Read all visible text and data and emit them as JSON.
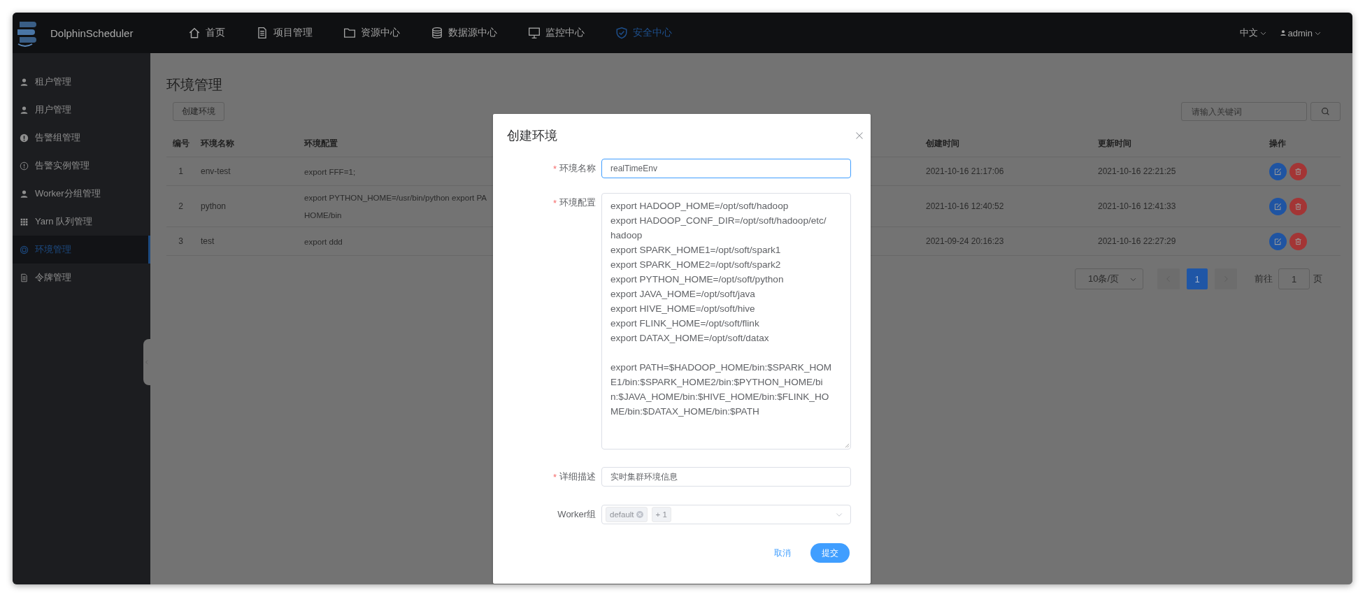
{
  "header": {
    "logo": "DolphinScheduler",
    "nav": [
      {
        "label": "首页",
        "selected": false
      },
      {
        "label": "项目管理",
        "selected": false
      },
      {
        "label": "资源中心",
        "selected": false
      },
      {
        "label": "数据源中心",
        "selected": false
      },
      {
        "label": "监控中心",
        "selected": false
      },
      {
        "label": "安全中心",
        "selected": true
      }
    ],
    "language": "中文",
    "user": "admin"
  },
  "sidebar": {
    "items": [
      {
        "label": "租户管理",
        "selected": false
      },
      {
        "label": "用户管理",
        "selected": false
      },
      {
        "label": "告警组管理",
        "selected": false
      },
      {
        "label": "告警实例管理",
        "selected": false
      },
      {
        "label": "Worker分组管理",
        "selected": false
      },
      {
        "label": "Yarn 队列管理",
        "selected": false
      },
      {
        "label": "环境管理",
        "selected": true
      },
      {
        "label": "令牌管理",
        "selected": false
      }
    ]
  },
  "page": {
    "title": "环境管理",
    "create_button": "创建环境",
    "search": {
      "placeholder": "请输入关键词"
    },
    "table": {
      "columns": [
        "编号",
        "环境名称",
        "环境配置",
        "创建时间",
        "更新时间",
        "操作"
      ],
      "rows": [
        {
          "id": "1",
          "name": "env-test",
          "config": "export FFF=1;",
          "created": "2021-10-16 21:17:06",
          "updated": "2021-10-16 22:21:25"
        },
        {
          "id": "2",
          "name": "python",
          "config": "export PYTHON_HOME=/usr/bin/python export PA\nHOME/bin",
          "created": "2021-10-16 12:40:52",
          "updated": "2021-10-16 12:41:33"
        },
        {
          "id": "3",
          "name": "test",
          "config": "export ddd",
          "created": "2021-09-24 20:16:23",
          "updated": "2021-10-16 22:27:29"
        }
      ]
    },
    "pagination": {
      "page_size": "10条/页",
      "pages": [
        {
          "label": "1",
          "selected": true
        }
      ],
      "goto_label": "前往",
      "goto_value": "1",
      "page_suffix": "页"
    }
  },
  "modal": {
    "title": "创建环境",
    "fields": [
      {
        "kind": "input",
        "label": "环境名称",
        "required_mark": "*",
        "value": "realTimeEnv",
        "focused": true
      },
      {
        "kind": "textarea",
        "label": "环境配置",
        "required_mark": "*",
        "value": "export HADOOP_HOME=/opt/soft/hadoop\nexport HADOOP_CONF_DIR=/opt/soft/hadoop/etc/\nhadoop\nexport SPARK_HOME1=/opt/soft/spark1\nexport SPARK_HOME2=/opt/soft/spark2\nexport PYTHON_HOME=/opt/soft/python\nexport JAVA_HOME=/opt/soft/java\nexport HIVE_HOME=/opt/soft/hive\nexport FLINK_HOME=/opt/soft/flink\nexport DATAX_HOME=/opt/soft/datax\n\nexport PATH=$HADOOP_HOME/bin:$SPARK_HOM\nE1/bin:$SPARK_HOME2/bin:$PYTHON_HOME/bi\nn:$JAVA_HOME/bin:$HIVE_HOME/bin:$FLINK_HO\nME/bin:$DATAX_HOME/bin:$PATH"
      },
      {
        "kind": "input",
        "label": "详细描述",
        "required_mark": "*",
        "value": "实时集群环境信息",
        "focused": false
      },
      {
        "kind": "select",
        "label": "Worker组",
        "tags": [
          {
            "label": "default",
            "closable": true
          },
          {
            "label": "+ 1",
            "closable": false
          }
        ]
      }
    ],
    "cancel": "取消",
    "submit": "提交"
  }
}
